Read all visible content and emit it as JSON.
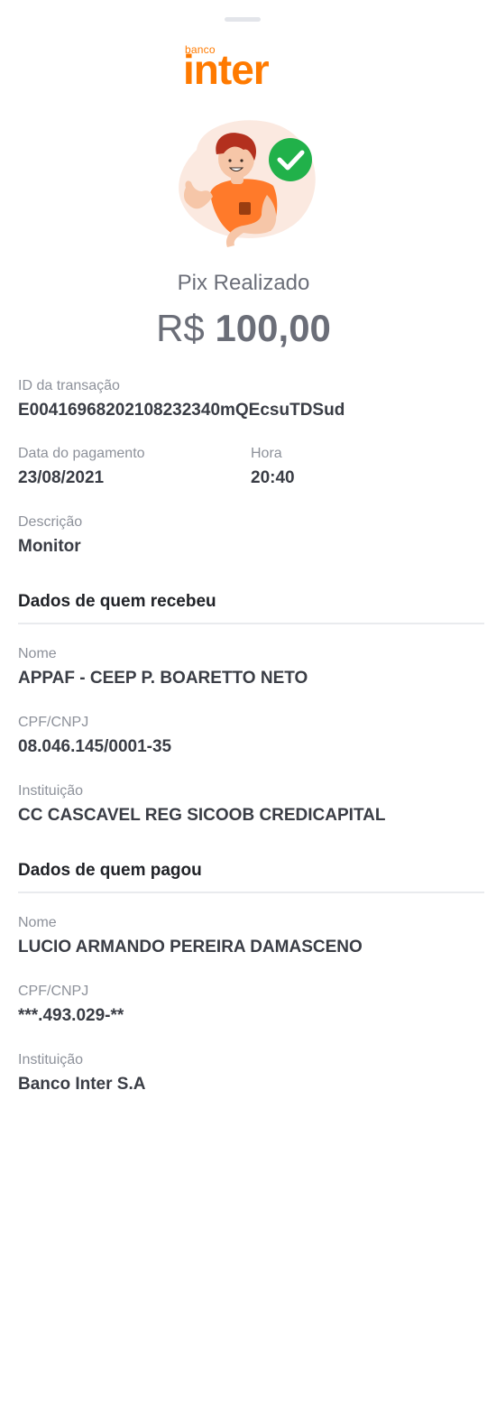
{
  "brand": {
    "small": "banco",
    "big": "inter",
    "color": "#ff7a00"
  },
  "header": {
    "title": "Pix Realizado",
    "currency": "R$",
    "amount": "100,00"
  },
  "transaction": {
    "id_label": "ID da transação",
    "id_value": "E00416968202108232340mQEcsuTDSud",
    "date_label": "Data do pagamento",
    "date_value": "23/08/2021",
    "time_label": "Hora",
    "time_value": "20:40",
    "desc_label": "Descrição",
    "desc_value": "Monitor"
  },
  "receiver": {
    "section_title": "Dados de quem recebeu",
    "name_label": "Nome",
    "name_value": "APPAF - CEEP P. BOARETTO NETO",
    "doc_label": "CPF/CNPJ",
    "doc_value": "08.046.145/0001-35",
    "inst_label": "Instituição",
    "inst_value": "CC CASCAVEL REG SICOOB CREDICAPITAL"
  },
  "payer": {
    "section_title": "Dados de quem pagou",
    "name_label": "Nome",
    "name_value": "LUCIO ARMANDO PEREIRA DAMASCENO",
    "doc_label": "CPF/CNPJ",
    "doc_value": "***.493.029-**",
    "inst_label": "Instituição",
    "inst_value": "Banco Inter S.A"
  },
  "colors": {
    "success": "#21b14a",
    "accent": "#ff7a00"
  },
  "icons": {
    "status": "check-circle-icon",
    "illustration": "person-thumbs-up-illustration"
  }
}
